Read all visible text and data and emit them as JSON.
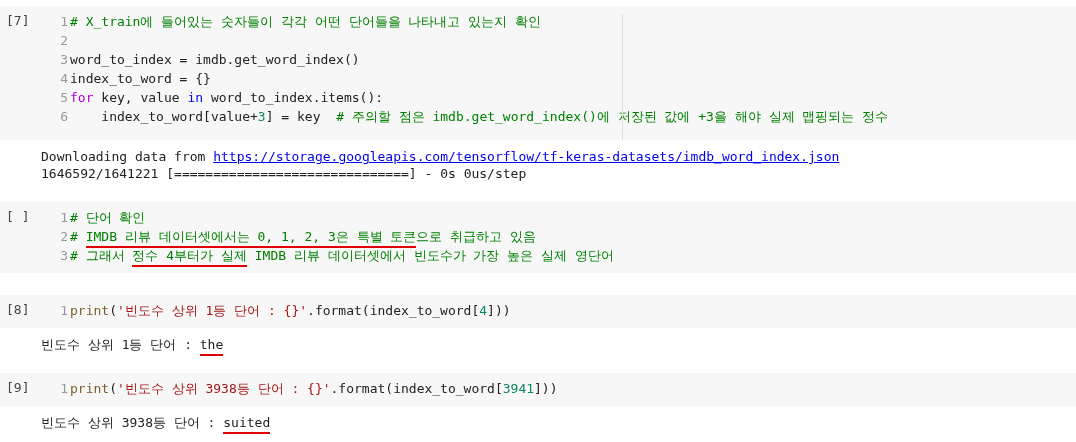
{
  "cells": [
    {
      "prompt": "[7]",
      "lines": [
        {
          "number": "1",
          "tokens": [
            {
              "kind": "comment",
              "text": "# X_train에 들어있는 숫자들이 각각 어떤 단어들을 나타내고 있는지 확인"
            }
          ]
        },
        {
          "number": "2"
        },
        {
          "number": "3",
          "tokens": [
            {
              "kind": "plain",
              "text": "word_to_index = imdb.get_word_index()"
            }
          ]
        },
        {
          "number": "4",
          "tokens": [
            {
              "kind": "plain",
              "text": "index_to_word = {}"
            }
          ]
        },
        {
          "number": "5",
          "tokens": [
            {
              "kind": "keyword",
              "text": "for"
            },
            {
              "kind": "plain",
              "text": " key, value "
            },
            {
              "kind": "operator",
              "text": "in"
            },
            {
              "kind": "plain",
              "text": " word_to_index.items():"
            }
          ]
        },
        {
          "number": "6",
          "tokens": [
            {
              "kind": "plain",
              "text": "    index_to_word[value+"
            },
            {
              "kind": "number",
              "text": "3"
            },
            {
              "kind": "plain",
              "text": "] = key  "
            },
            {
              "kind": "comment",
              "text": "# 주의할 점은 imdb.get_word_index()에 저장된 값에 +3을 해야 실제 맵핑되는 정수"
            }
          ]
        }
      ],
      "output": [
        [
          {
            "kind": "plain",
            "text": "Downloading data from "
          },
          {
            "kind": "link",
            "text": "https://storage.googleapis.com/tensorflow/tf-keras-datasets/imdb_word_index.json"
          }
        ],
        [
          {
            "kind": "plain",
            "text": "1646592/1641221 [==============================] - 0s 0us/step"
          }
        ]
      ]
    },
    {
      "prompt": "[ ]",
      "lines": [
        {
          "number": "1",
          "tokens": [
            {
              "kind": "comment",
              "text": "# 단어 확인"
            }
          ]
        },
        {
          "number": "2",
          "tokens": [
            {
              "kind": "comment",
              "text": "# "
            },
            {
              "kind": "comment",
              "text": "IMDB 리뷰 데이터셋에서는 0, 1, 2, 3은 특별 토큰",
              "underlined": true
            },
            {
              "kind": "comment",
              "text": "으로 취급하고 있음"
            }
          ]
        },
        {
          "number": "3",
          "tokens": [
            {
              "kind": "comment",
              "text": "# 그래서 "
            },
            {
              "kind": "comment",
              "text": "정수 4부터가 실제",
              "underlined": true
            },
            {
              "kind": "comment",
              "text": " IMDB 리뷰 데이터셋에서 빈도수가 가장 높은 실제 영단어"
            }
          ]
        }
      ]
    },
    {
      "prompt": "[8]",
      "lines": [
        {
          "number": "1",
          "tokens": [
            {
              "kind": "function",
              "text": "print"
            },
            {
              "kind": "plain",
              "text": "("
            },
            {
              "kind": "string",
              "text": "'빈도수 상위 1등 단어 : {}'"
            },
            {
              "kind": "plain",
              "text": ".format(index_to_word["
            },
            {
              "kind": "number",
              "text": "4"
            },
            {
              "kind": "plain",
              "text": "]))"
            }
          ]
        }
      ],
      "output": [
        [
          {
            "kind": "plain",
            "text": "빈도수 상위 1등 단어 : "
          },
          {
            "kind": "plain",
            "text": "the",
            "underlined": true
          }
        ]
      ]
    },
    {
      "prompt": "[9]",
      "lines": [
        {
          "number": "1",
          "tokens": [
            {
              "kind": "function",
              "text": "print"
            },
            {
              "kind": "plain",
              "text": "("
            },
            {
              "kind": "string",
              "text": "'빈도수 상위 3938등 단어 : {}'"
            },
            {
              "kind": "plain",
              "text": ".format(index_to_word["
            },
            {
              "kind": "number",
              "text": "3941"
            },
            {
              "kind": "plain",
              "text": "]))"
            }
          ]
        }
      ],
      "output": [
        [
          {
            "kind": "plain",
            "text": "빈도수 상위 3938등 단어 : "
          },
          {
            "kind": "plain",
            "text": "suited",
            "underlined": true
          }
        ]
      ]
    }
  ]
}
